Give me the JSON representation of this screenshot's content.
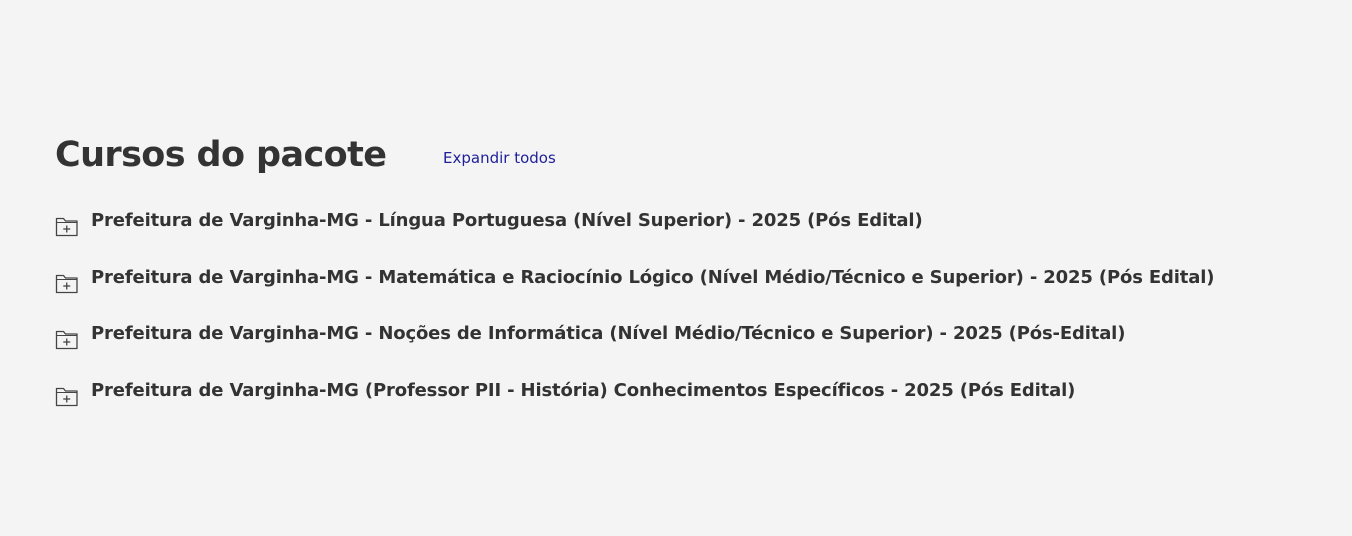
{
  "section": {
    "title": "Cursos do pacote",
    "expand_all_label": "Expandir todos"
  },
  "courses": [
    {
      "label": "Prefeitura de Varginha-MG - Língua Portuguesa (Nível Superior) - 2025 (Pós Edital)",
      "icon": "folder-plus-icon"
    },
    {
      "label": "Prefeitura de Varginha-MG - Matemática e Raciocínio Lógico (Nível Médio/Técnico e Superior) - 2025 (Pós Edital)",
      "icon": "folder-plus-icon"
    },
    {
      "label": "Prefeitura de Varginha-MG - Noções de Informática (Nível Médio/Técnico e Superior) - 2025 (Pós-Edital)",
      "icon": "folder-plus-icon"
    },
    {
      "label": "Prefeitura de Varginha-MG (Professor PII - História) Conhecimentos Específicos - 2025 (Pós Edital)",
      "icon": "folder-plus-icon"
    }
  ],
  "colors": {
    "background": "#f4f4f4",
    "text": "#333333",
    "link": "#1f1f99"
  }
}
